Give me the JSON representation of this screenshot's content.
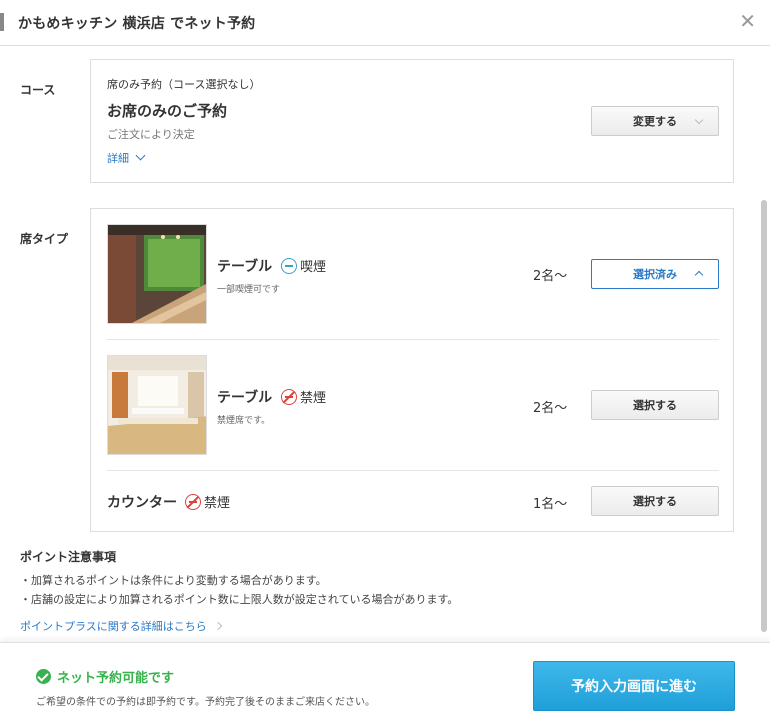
{
  "header": {
    "title": "かもめキッチン 横浜店 でネット予約",
    "close_icon": "close-icon"
  },
  "course": {
    "label": "コース",
    "sub": "席のみ予約（コース選択なし）",
    "title": "お席のみのご予約",
    "note": "ご注文により決定",
    "detail_link": "詳細",
    "change_button": "変更する"
  },
  "seat": {
    "label": "席タイプ",
    "items": [
      {
        "name": "テーブル",
        "type": "喫煙",
        "type_icon": "smoking-icon",
        "desc": "一部喫煙可です",
        "capacity": "2名〜",
        "button": "選択済み",
        "selected": true
      },
      {
        "name": "テーブル",
        "type": "禁煙",
        "type_icon": "no-smoking-icon",
        "desc": "禁煙席です。",
        "capacity": "2名〜",
        "button": "選択する",
        "selected": false
      },
      {
        "name": "カウンター",
        "type": "禁煙",
        "type_icon": "no-smoking-icon",
        "desc": "",
        "capacity": "1名〜",
        "button": "選択する",
        "selected": false
      }
    ]
  },
  "points": {
    "title": "ポイント注意事項",
    "lines": [
      "・加算されるポイントは条件により変動する場合があります。",
      "・店舗の設定により加算されるポイント数に上限人数が設定されている場合があります。"
    ],
    "link": "ポイントプラスに関する詳細はこちら"
  },
  "footer": {
    "status": "ネット予約可能です",
    "status_sub": "ご希望の条件での予約は即予約です。予約完了後そのままご来店ください。",
    "proceed": "予約入力画面に進む"
  },
  "colors": {
    "accent_blue": "#2a7ac8",
    "cta_blue": "#1f9fd9",
    "success_green": "#37b24d",
    "no_smoking_red": "#e0403a",
    "smoking_blue": "#39a0c9"
  }
}
